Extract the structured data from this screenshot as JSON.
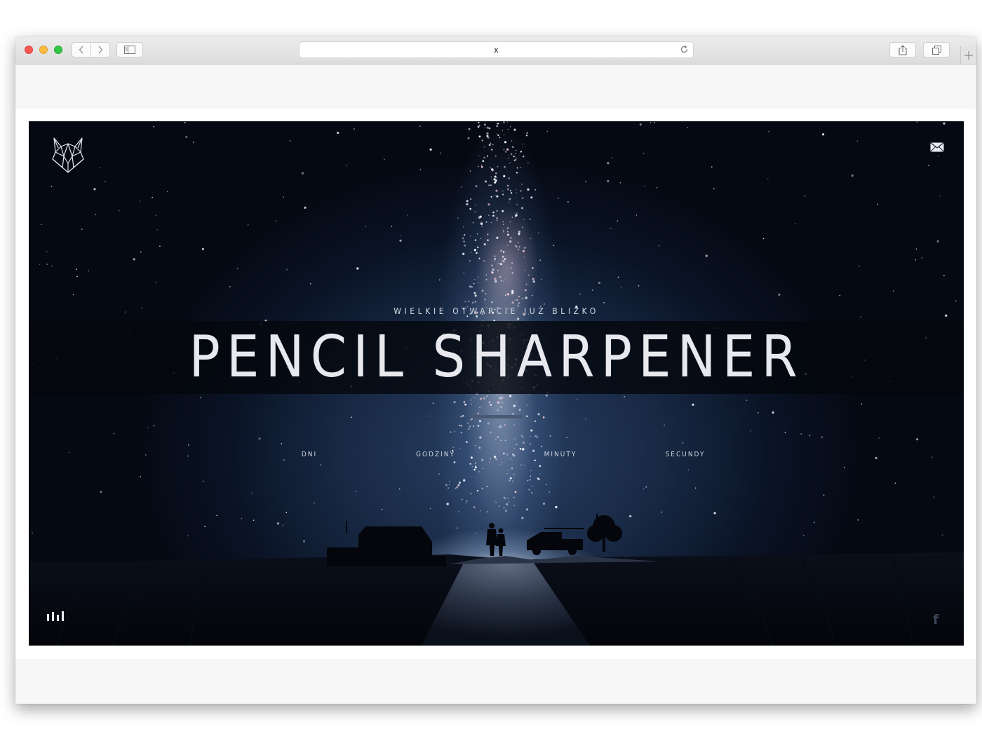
{
  "browser": {
    "address": "x"
  },
  "hero": {
    "subtitle": "WIELKIE OTWARCIE JUŻ BLIŻKO",
    "title": "PENCIL SHARPENER",
    "countdown": [
      {
        "label": "DNI"
      },
      {
        "label": "GODZINY"
      },
      {
        "label": "MINUTY"
      },
      {
        "label": "SECUNDY"
      }
    ],
    "facebook": "f"
  },
  "icons": {
    "logo": "wolf-logo-icon",
    "mail": "envelope-icon",
    "menu": "bars-menu-icon",
    "social": "facebook-icon"
  },
  "colors": {
    "sky": "#0a1325",
    "title": "#e7e9ee",
    "divider": "#4a5a74"
  }
}
